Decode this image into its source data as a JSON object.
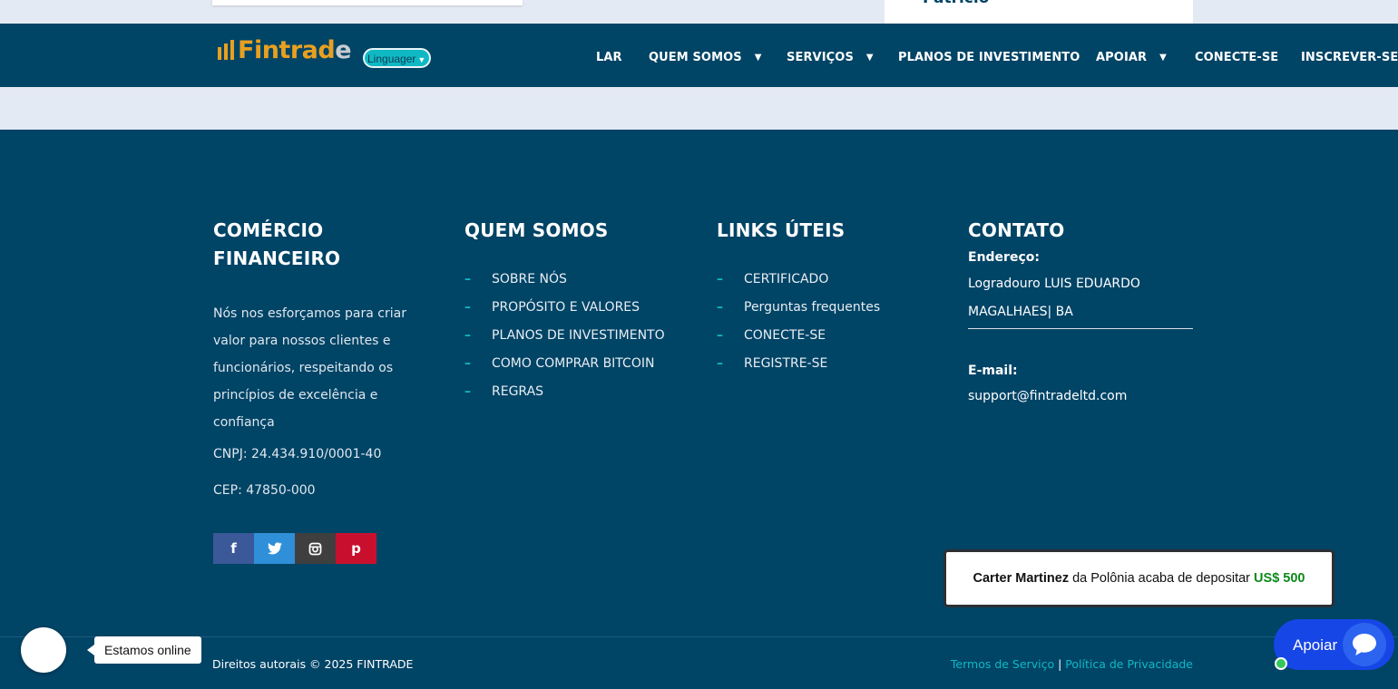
{
  "top_strip": {
    "card_title": "Patrício"
  },
  "header": {
    "logo": {
      "main": "Fintrad",
      "tail": "e"
    },
    "language_select": {
      "value": "Linguager"
    },
    "nav": [
      {
        "label": "LAR",
        "dropdown": false
      },
      {
        "label": "QUEM SOMOS",
        "dropdown": true
      },
      {
        "label": "SERVIÇOS",
        "dropdown": true
      },
      {
        "label": "PLANOS DE INVESTIMENTO",
        "dropdown": false
      },
      {
        "label": "APOIAR",
        "dropdown": true
      },
      {
        "label": "CONECTE-SE",
        "dropdown": false
      },
      {
        "label": "INSCREVER-SE",
        "dropdown": false
      }
    ]
  },
  "footer": {
    "about": {
      "title": "COMÉRCIO FINANCEIRO",
      "text": "Nós nos esforçamos para criar valor para nossos clientes e funcionários, respeitando os princípios de excelência e confiança",
      "cnpj": "CNPJ: 24.434.910/0001-40",
      "cep": "CEP: 47850-000"
    },
    "who_we_are": {
      "title": "QUEM SOMOS",
      "links": [
        "SOBRE NÓS",
        "PROPÓSITO E VALORES",
        "PLANOS DE INVESTIMENTO",
        "COMO COMPRAR BITCOIN",
        "REGRAS"
      ]
    },
    "useful_links": {
      "title": "LINKS ÚTEIS",
      "links": [
        "CERTIFICADO",
        "Perguntas frequentes",
        "CONECTE-SE",
        "REGISTRE-SE"
      ]
    },
    "contact": {
      "title": "CONTATO",
      "address_label": "Endereço:",
      "address_line1": "Logradouro LUIS EDUARDO",
      "address_line2": "MAGALHAES| BA",
      "email_label": "E-mail:",
      "email": "support@fintradeltd.com"
    },
    "social": [
      {
        "icon": "facebook-icon",
        "glyph": "f",
        "color": "#3b5998"
      },
      {
        "icon": "twitter-icon",
        "glyph": "🐦",
        "color": "#2f8fd8"
      },
      {
        "icon": "instagram-icon",
        "glyph": "◙",
        "color": "#3f3f3f"
      },
      {
        "icon": "pinterest-icon",
        "glyph": "p",
        "color": "#c8102e"
      }
    ],
    "copyright": "Direitos autorais © 2025 FINTRADE",
    "terms": "Termos de Serviço",
    "separator": "|",
    "privacy": "Política de Privacidade"
  },
  "toast": {
    "name": "Carter Martinez",
    "middle": " da Polônia acaba de depositar ",
    "amount": "US$ 500"
  },
  "chat": {
    "online_text": "Estamos online",
    "support_label": "Apoiar"
  }
}
